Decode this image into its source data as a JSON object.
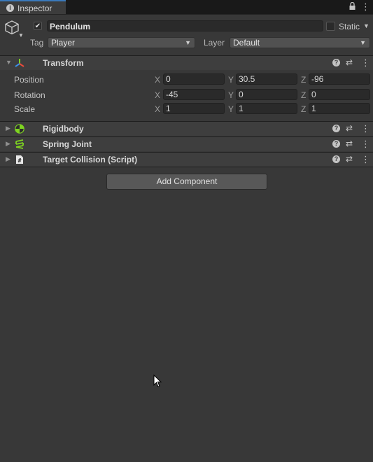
{
  "tab": {
    "label": "Inspector",
    "icon": "info-icon"
  },
  "header": {
    "name": "Pendulum",
    "active": true,
    "static_label": "Static",
    "tag_label": "Tag",
    "tag_value": "Player",
    "layer_label": "Layer",
    "layer_value": "Default"
  },
  "transform": {
    "title": "Transform",
    "rows": [
      {
        "label": "Position",
        "x": "0",
        "y": "30.5",
        "z": "-96"
      },
      {
        "label": "Rotation",
        "x": "-45",
        "y": "0",
        "z": "0"
      },
      {
        "label": "Scale",
        "x": "1",
        "y": "1",
        "z": "1"
      }
    ],
    "axis": {
      "x": "X",
      "y": "Y",
      "z": "Z"
    }
  },
  "components": [
    {
      "title": "Rigidbody",
      "icon": "rigidbody-icon"
    },
    {
      "title": "Spring Joint",
      "icon": "spring-joint-icon"
    },
    {
      "title": "Target Collision (Script)",
      "icon": "script-icon"
    }
  ],
  "add_component_label": "Add Component",
  "colors": {
    "accent": "#3a79bb",
    "panel_bg": "#383838",
    "field_bg": "#2a2a2a"
  }
}
